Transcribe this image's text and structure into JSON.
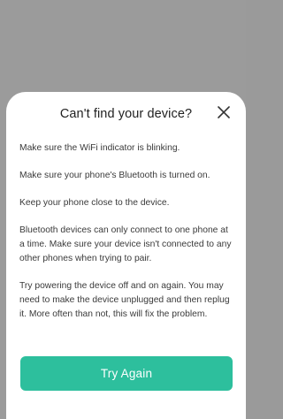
{
  "dialog": {
    "title": "Can't find your device?",
    "close_icon": "close-icon",
    "tips": [
      "Make sure the WiFi indicator is blinking.",
      "Make sure your phone's Bluetooth is turned on.",
      "Keep your phone close to the device.",
      "Bluetooth devices can only connect to one phone at a time. Make sure your device isn't connected to any other phones when trying to pair.",
      "Try powering the device off and on again. You may need to make the device unplugged and then replug it. More often than not, this will fix the problem."
    ],
    "primary_button_label": "Try Again",
    "accent_color": "#2dbf9d"
  }
}
